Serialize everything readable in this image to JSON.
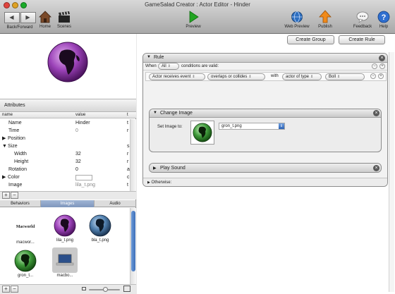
{
  "window": {
    "title": "GameSalad Creator : Actor Editor - Hinder"
  },
  "toolbar": {
    "back_forward_label": "Back/Forward",
    "home_label": "Home",
    "scenes_label": "Scenes",
    "preview_label": "Preview",
    "web_preview_label": "Web Preview",
    "publish_label": "Publish",
    "feedback_label": "Feedback",
    "help_label": "Help"
  },
  "attributes": {
    "header": "Attributes",
    "columns": [
      "name",
      "value",
      "t"
    ],
    "rows": [
      {
        "name": "Name",
        "value": "Hinder",
        "type": "t"
      },
      {
        "name": "Time",
        "value": "0",
        "type": "r"
      },
      {
        "name": "Position",
        "value": "",
        "type": ""
      },
      {
        "name": "Size",
        "value": "",
        "type": "s"
      },
      {
        "name": "Width",
        "value": "32",
        "type": "r"
      },
      {
        "name": "Height",
        "value": "32",
        "type": "r"
      },
      {
        "name": "Rotation",
        "value": "0",
        "type": "a"
      },
      {
        "name": "Color",
        "value": "",
        "type": "c"
      },
      {
        "name": "Image",
        "value": "lila_t.png",
        "type": "t"
      }
    ]
  },
  "library": {
    "tabs": [
      "Behaviors",
      "Images",
      "Audio"
    ],
    "active_tab": "Images",
    "items": [
      {
        "label": "macwor..."
      },
      {
        "label": "lila_t.png"
      },
      {
        "label": "bla_t.png"
      },
      {
        "label": "gron_t..."
      },
      {
        "label": "macbo..."
      }
    ],
    "thumbnail_text": "Macworld"
  },
  "editor": {
    "create_group_label": "Create Group",
    "create_rule_label": "Create Rule",
    "rule": {
      "title": "Rule",
      "when_label": "When",
      "when_value": "All",
      "conditions_label": "conditions are valid:",
      "condition": {
        "event": "Actor receives event",
        "operator": "overlaps or collides",
        "with_label": "with",
        "target_type": "actor of type",
        "target": "Boll"
      },
      "change_image": {
        "title": "Change Image",
        "set_image_label": "Set Image to:",
        "image_value": "gron_t.png"
      },
      "play_sound": {
        "title": "Play Sound"
      },
      "otherwise_label": "Otherwise:"
    }
  },
  "colors": {
    "purple_orb": "#8b3aa6",
    "blue_orb": "#3a6c9a",
    "green_orb": "#2f8f2f"
  }
}
